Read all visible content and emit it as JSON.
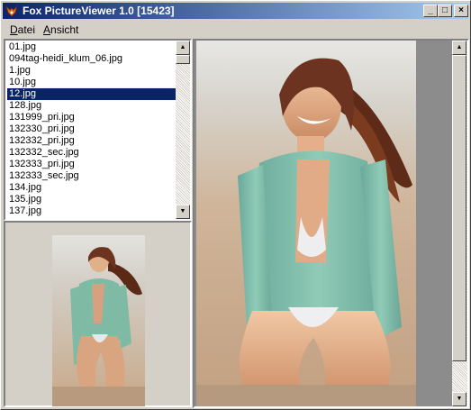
{
  "window": {
    "title": "Fox PictureViewer 1.0 [15423]",
    "controls": {
      "minimize": "_",
      "maximize": "□",
      "close": "×"
    }
  },
  "menu": {
    "items": [
      "Datei",
      "Ansicht"
    ]
  },
  "file_list": {
    "items": [
      "01.jpg",
      "094tag-heidi_klum_06.jpg",
      "1.jpg",
      "10.jpg",
      "12.jpg",
      "128.jpg",
      "131999_pri.jpg",
      "132330_pri.jpg",
      "132332_pri.jpg",
      "132332_sec.jpg",
      "132333_pri.jpg",
      "132333_sec.jpg",
      "134.jpg",
      "135.jpg",
      "137.jpg"
    ],
    "selected": "12.jpg"
  },
  "icons": {
    "app": "fox-icon",
    "scroll_up": "▲",
    "scroll_down": "▼"
  },
  "colors": {
    "titlebar_start": "#0a246a",
    "titlebar_end": "#a6caf0",
    "selection": "#0a246a"
  }
}
